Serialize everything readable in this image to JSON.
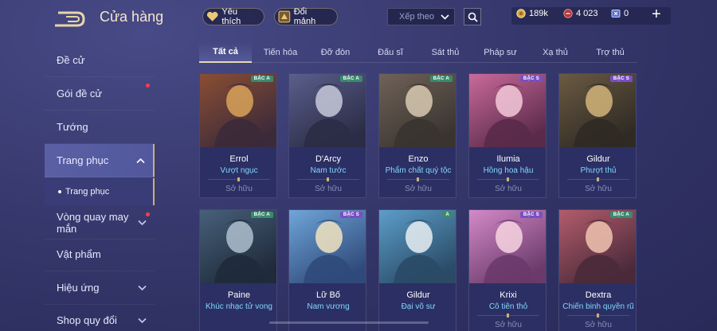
{
  "store": {
    "title": "Cửa hàng"
  },
  "sidebar": {
    "items": [
      {
        "label": "Đề cử"
      },
      {
        "label": "Gói đề cử"
      },
      {
        "label": "Tướng"
      },
      {
        "label": "Trang phục"
      },
      {
        "label": "Vòng quay may mắn"
      },
      {
        "label": "Vật phẩm"
      },
      {
        "label": "Hiệu ứng"
      },
      {
        "label": "Shop quy đổi"
      }
    ],
    "sub_item": "Trang phục"
  },
  "topbar": {
    "favorites_label": "Yêu thích",
    "exchange_label": "Đổi mảnh",
    "sort_placeholder": "Xếp theo",
    "gold": "189k",
    "vouchers": "4 023",
    "tickets": "0"
  },
  "tabs": [
    {
      "label": "Tất cả"
    },
    {
      "label": "Tiến hóa"
    },
    {
      "label": "Đỡ đòn"
    },
    {
      "label": "Đấu sĩ"
    },
    {
      "label": "Sát thủ"
    },
    {
      "label": "Pháp sư"
    },
    {
      "label": "Xạ thủ"
    },
    {
      "label": "Trợ thủ"
    }
  ],
  "cards": [
    {
      "hero": "Errol",
      "skin": "Vượt ngục",
      "rank": "BẬC A",
      "status": "Sở hữu",
      "colors": [
        "#3b2a3a",
        "#8a4e33",
        "#d9a35a"
      ]
    },
    {
      "hero": "D'Arcy",
      "skin": "Nam tước",
      "rank": "BẬC A",
      "status": "Sở hữu",
      "colors": [
        "#2b2c45",
        "#5a5f8c",
        "#c7c9d9"
      ]
    },
    {
      "hero": "Enzo",
      "skin": "Phẩm chất quý tộc",
      "rank": "BẬC A",
      "status": "Sở hữu",
      "colors": [
        "#3a3430",
        "#6f6258",
        "#d8cab3"
      ]
    },
    {
      "hero": "Ilumia",
      "skin": "Hồng hoa hậu",
      "rank": "BẬC S",
      "status": "Sở hữu",
      "colors": [
        "#5a2a4a",
        "#c96a9a",
        "#f3c9d9"
      ]
    },
    {
      "hero": "Gildur",
      "skin": "Phượt thủ",
      "rank": "BẬC S",
      "status": "Sở hữu",
      "colors": [
        "#2f2a24",
        "#6a5a42",
        "#d2b47a"
      ]
    },
    {
      "hero": "Paine",
      "skin": "Khúc nhạc tử vong",
      "rank": "BẬC A",
      "status": "",
      "colors": [
        "#1f2a3a",
        "#47607a",
        "#aec0cf"
      ]
    },
    {
      "hero": "Lữ Bố",
      "skin": "Nam vương",
      "rank": "BẬC S",
      "status": "",
      "colors": [
        "#2f4a7a",
        "#6fa6d9",
        "#f2e3c0"
      ]
    },
    {
      "hero": "Gildur",
      "skin": "Đại võ sư",
      "rank": "A",
      "status": "",
      "colors": [
        "#2a4a66",
        "#5c9ec9",
        "#e9eef2"
      ]
    },
    {
      "hero": "Krixi",
      "skin": "Cô tiên thỏ",
      "rank": "BẬC S",
      "status": "Sở hữu",
      "colors": [
        "#6a3a6a",
        "#d48ac8",
        "#f7d5e0"
      ]
    },
    {
      "hero": "Dextra",
      "skin": "Chiến binh quyền rũ",
      "rank": "BẬC A",
      "status": "Sở hữu",
      "colors": [
        "#4a2a3a",
        "#b35c6c",
        "#f0c4b0"
      ]
    }
  ]
}
